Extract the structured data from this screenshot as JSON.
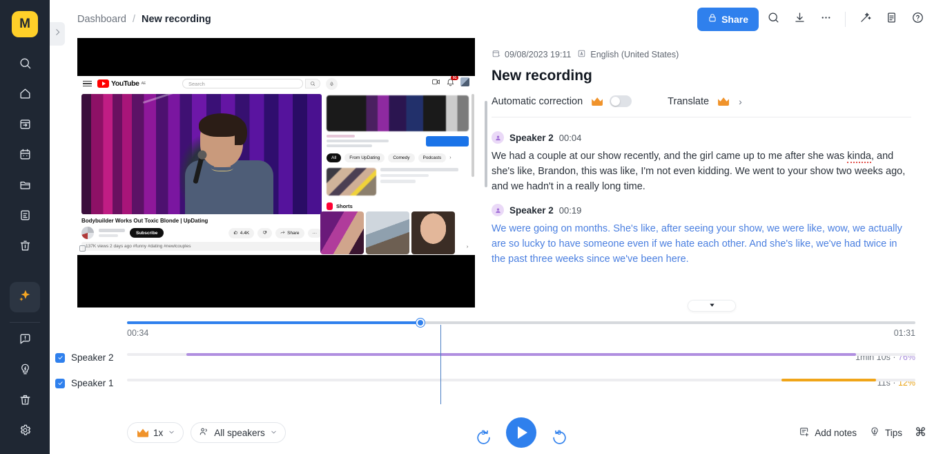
{
  "rail": {
    "logo_label": "M",
    "items": [
      {
        "name": "search",
        "icon": "search-icon"
      },
      {
        "name": "home",
        "icon": "home-icon"
      },
      {
        "name": "import",
        "icon": "import-calendar-icon"
      },
      {
        "name": "calendar",
        "icon": "calendar-icon"
      },
      {
        "name": "folders",
        "icon": "folder-icon"
      },
      {
        "name": "notes",
        "icon": "note-icon"
      },
      {
        "name": "trash",
        "icon": "trash-icon"
      }
    ],
    "ai_icon": "sparkles-icon",
    "bottom_items": [
      {
        "name": "feedback",
        "icon": "chat-alert-icon"
      },
      {
        "name": "whats-new",
        "icon": "lightbulb-icon"
      },
      {
        "name": "bin",
        "icon": "trash-icon"
      },
      {
        "name": "settings",
        "icon": "gear-icon"
      }
    ],
    "collapse_icon": "chevron-right-icon"
  },
  "header": {
    "breadcrumb_root": "Dashboard",
    "breadcrumb_sep": "/",
    "breadcrumb_current": "New recording",
    "share_label": "Share",
    "share_color": "#2f80ed",
    "icons": [
      {
        "name": "search-icon"
      },
      {
        "name": "download-icon"
      },
      {
        "name": "more-horizontal-icon"
      },
      {
        "name": "magic-wand-icon"
      },
      {
        "name": "document-icon"
      },
      {
        "name": "help-circle-icon"
      }
    ]
  },
  "video": {
    "yt_wordmark": "YouTube",
    "yt_tm": "AE",
    "search_placeholder": "Search",
    "notification_count": "91",
    "video_title": "Bodybuilder Works Out Toxic Blonde | UpDating",
    "subscribe_label": "Subscribe",
    "like_count": "4.4K",
    "share_label": "Share",
    "view_meta": "137K views  2 days ago  #funny #dating #newlcouples",
    "chips": [
      "All",
      "From UpDating",
      "Comedy",
      "Podcasts"
    ],
    "chip_arrow": "›",
    "shorts_label": "Shorts"
  },
  "transcript": {
    "date": "09/08/2023 19:11",
    "language": "English (United States)",
    "title": "New recording",
    "automatic_correction_label": "Automatic correction",
    "automatic_correction_on": false,
    "translate_label": "Translate",
    "translate_chevron": "›",
    "segments": [
      {
        "speaker": "Speaker 2",
        "time": "00:04",
        "active": false,
        "text_before": "We had a couple at our show recently, and the girl came up to me after she was ",
        "misspelled": "kinda",
        "text_after": ", and she's like, Brandon, this was like, I'm not even kidding. We went to your show two weeks ago, and we hadn't in a really long time."
      },
      {
        "speaker": "Speaker 2",
        "time": "00:19",
        "active": true,
        "text_before": "We were going on months. She's like, after seeing your show, we were like, wow, we actually are so lucky to have someone even if we hate each other. And she's like, we've had twice in the past three weeks since we've been here.",
        "misspelled": "",
        "text_after": ""
      }
    ]
  },
  "timeline": {
    "current_time": "00:34",
    "total_time": "01:31",
    "progress_percent": 37.2,
    "speakers": [
      {
        "name": "Speaker 2",
        "checked": true,
        "duration": "1min 10s",
        "separator": "·",
        "percent": "76%",
        "color": "#b08ee0",
        "segments": [
          {
            "start": 7.5,
            "width": 85.0
          }
        ]
      },
      {
        "name": "Speaker 1",
        "checked": true,
        "duration": "11s",
        "separator": "·",
        "percent": "12%",
        "color": "#f0a519",
        "segments": [
          {
            "start": 83.0,
            "width": 12.0
          }
        ]
      }
    ]
  },
  "player": {
    "speed_label": "1x",
    "speakers_filter_label": "All speakers",
    "rewind_seconds": "3",
    "forward_seconds": "3",
    "play_state": "paused",
    "add_notes_label": "Add notes",
    "tips_label": "Tips",
    "shortcut_symbol": "⌘"
  }
}
